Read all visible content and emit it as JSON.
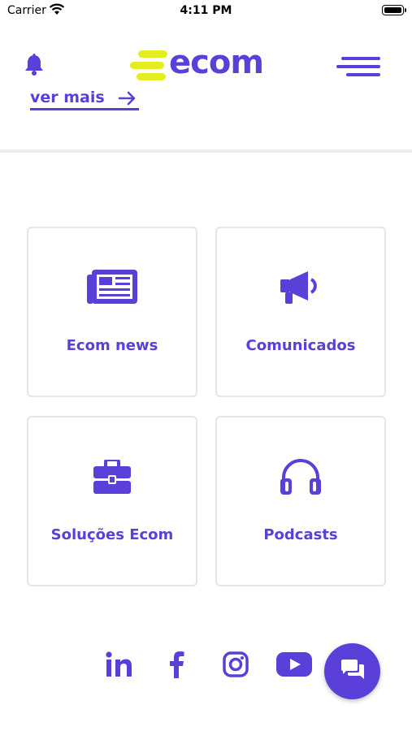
{
  "status_bar": {
    "carrier": "Carrier",
    "time": "4:11 PM"
  },
  "header": {
    "logo_text": "ecom",
    "bell_icon": "bell-icon",
    "menu_icon": "hamburger-menu-icon"
  },
  "see_more": {
    "label": "ver mais",
    "icon": "arrow-right-icon"
  },
  "cards": [
    {
      "label": "Ecom news",
      "icon": "newspaper-icon"
    },
    {
      "label": "Comunicados",
      "icon": "megaphone-icon"
    },
    {
      "label": "Soluções Ecom",
      "icon": "briefcase-icon"
    },
    {
      "label": "Podcasts",
      "icon": "headphones-icon"
    }
  ],
  "social": [
    {
      "name": "LinkedIn",
      "icon": "linkedin-icon"
    },
    {
      "name": "Facebook",
      "icon": "facebook-icon"
    },
    {
      "name": "Instagram",
      "icon": "instagram-icon"
    },
    {
      "name": "YouTube",
      "icon": "youtube-icon"
    }
  ],
  "chat_button": {
    "icon": "chat-icon"
  },
  "colors": {
    "brand": "#5a3fd8",
    "logo_accent": "#e4ed1f",
    "divider": "#ececec",
    "card_border": "#e6e6e6"
  }
}
